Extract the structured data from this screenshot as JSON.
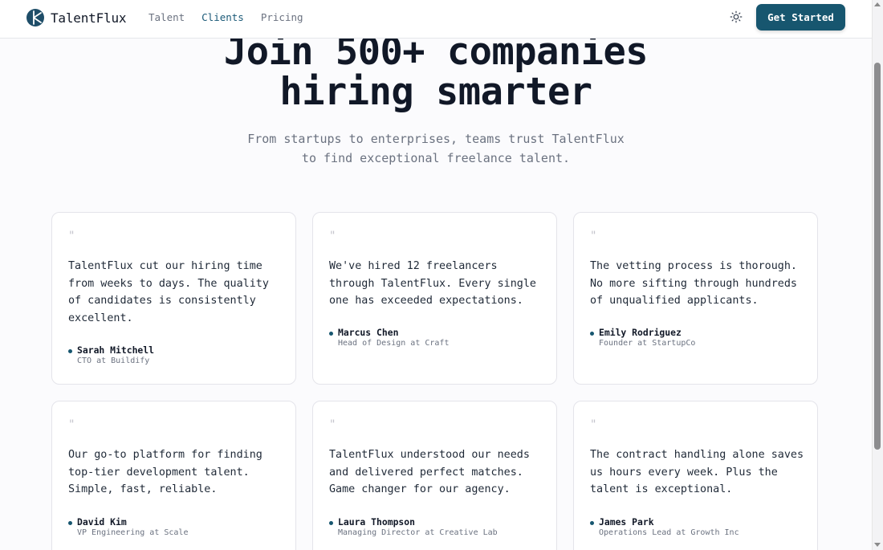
{
  "navbar": {
    "brand": "TalentFlux",
    "links": [
      {
        "label": "Talent",
        "active": false
      },
      {
        "label": "Clients",
        "active": true
      },
      {
        "label": "Pricing",
        "active": false
      }
    ],
    "theme_icon": "sun-icon",
    "cta_label": "Get Started"
  },
  "hero": {
    "title_line1": "Join 500+ companies",
    "title_line2": "hiring smarter",
    "subtitle_line1": "From startups to enterprises, teams trust TalentFlux",
    "subtitle_line2": "to find exceptional freelance talent."
  },
  "testimonials": [
    {
      "quote_mark": "\"",
      "text": "TalentFlux cut our hiring time from weeks to days. The quality of candidates is consistently excellent.",
      "name": "Sarah Mitchell",
      "role": "CTO at Buildify"
    },
    {
      "quote_mark": "\"",
      "text": "We've hired 12 freelancers through TalentFlux. Every single one has exceeded expectations.",
      "name": "Marcus Chen",
      "role": "Head of Design at Craft"
    },
    {
      "quote_mark": "\"",
      "text": "The vetting process is thorough. No more sifting through hundreds of unqualified applicants.",
      "name": "Emily Rodriguez",
      "role": "Founder at StartupCo"
    },
    {
      "quote_mark": "\"",
      "text": "Our go-to platform for finding top-tier development talent. Simple, fast, reliable.",
      "name": "David Kim",
      "role": "VP Engineering at Scale"
    },
    {
      "quote_mark": "\"",
      "text": "TalentFlux understood our needs and delivered perfect matches. Game changer for our agency.",
      "name": "Laura Thompson",
      "role": "Managing Director at Creative Lab"
    },
    {
      "quote_mark": "\"",
      "text": "The contract handling alone saves us hours every week. Plus the talent is exceptional.",
      "name": "James Park",
      "role": "Operations Lead at Growth Inc"
    }
  ],
  "colors": {
    "accent": "#17566f",
    "background": "#fbfbfd",
    "text": "#111827",
    "muted": "#6b7280"
  }
}
